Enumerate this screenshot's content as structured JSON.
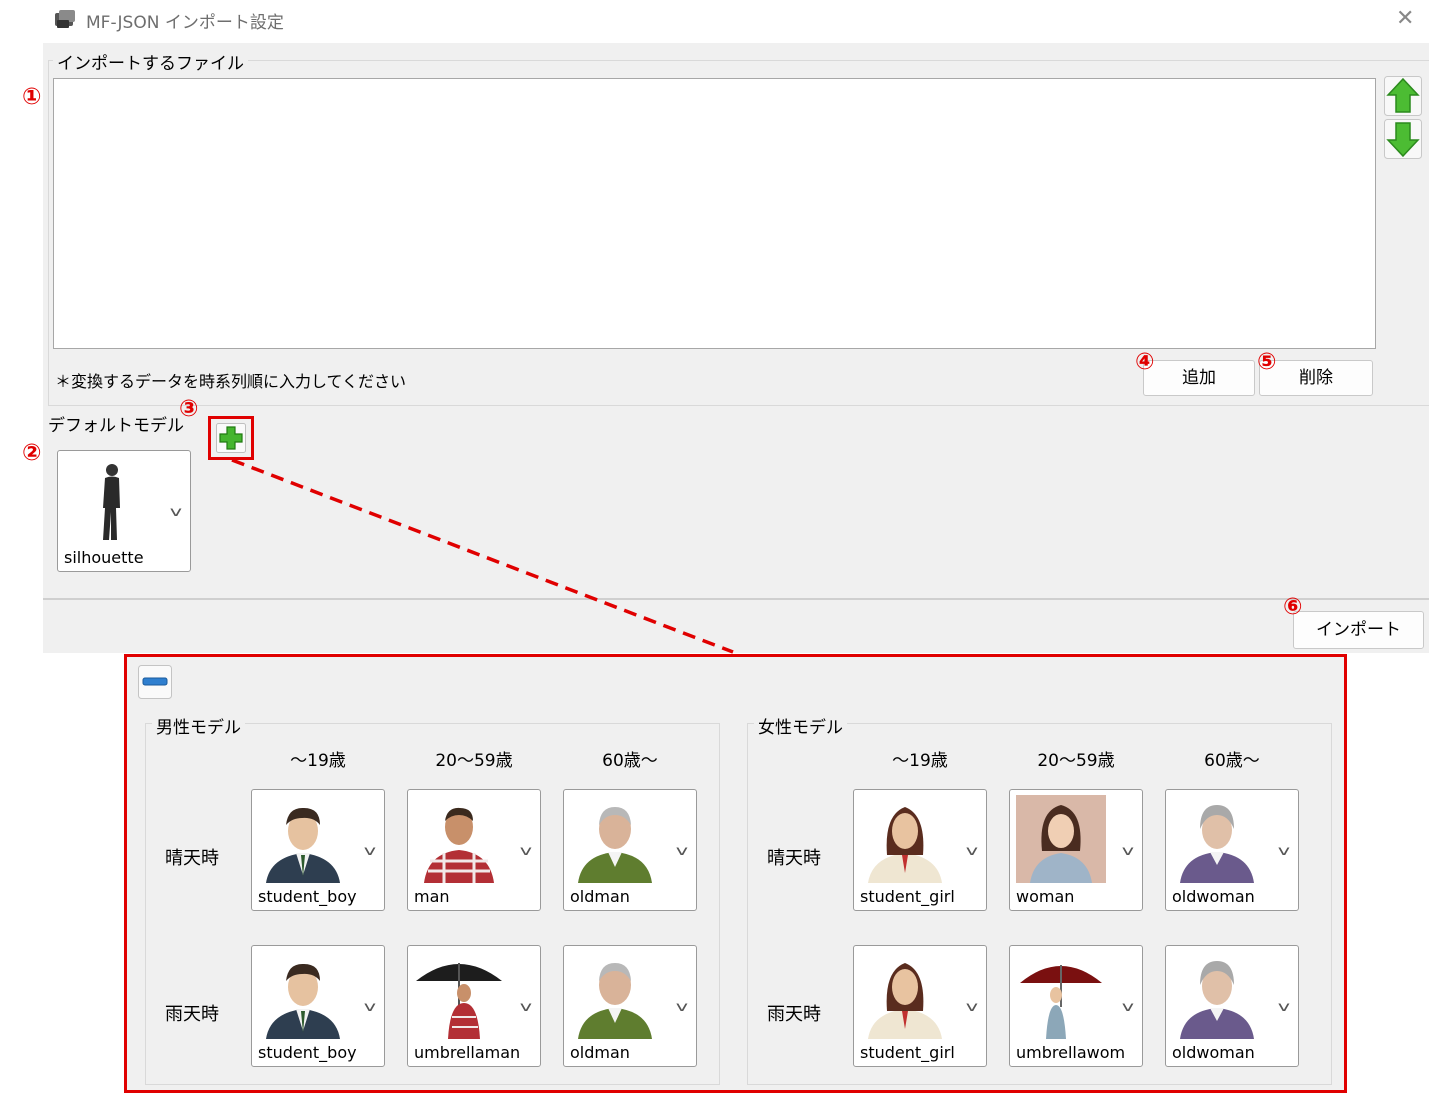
{
  "window": {
    "title": "MF-JSON インポート設定"
  },
  "import_group": {
    "label": "インポートするファイル",
    "note": "＊変換するデータを時系列順に入力してください",
    "add_label": "追加",
    "delete_label": "削除"
  },
  "default_model": {
    "label": "デフォルトモデル",
    "model_name": "silhouette"
  },
  "footer": {
    "import_label": "インポート"
  },
  "callouts": [
    "①",
    "②",
    "③",
    "④",
    "⑤",
    "⑥"
  ],
  "model_panel": {
    "male": {
      "label": "男性モデル",
      "columns": [
        "〜19歳",
        "20〜59歳",
        "60歳〜"
      ],
      "rows": [
        {
          "label": "晴天時",
          "models": [
            "student_boy",
            "man",
            "oldman"
          ]
        },
        {
          "label": "雨天時",
          "models": [
            "student_boy",
            "umbrellaman",
            "oldman"
          ]
        }
      ]
    },
    "female": {
      "label": "女性モデル",
      "columns": [
        "〜19歳",
        "20〜59歳",
        "60歳〜"
      ],
      "rows": [
        {
          "label": "晴天時",
          "models": [
            "student_girl",
            "woman",
            "oldwoman"
          ]
        },
        {
          "label": "雨天時",
          "models": [
            "student_girl",
            "umbrellawom",
            "oldwoman"
          ]
        }
      ]
    }
  },
  "colors": {
    "callout": "#e00000",
    "arrow_green": "#3fae29",
    "minus_blue": "#2f7fcf"
  }
}
